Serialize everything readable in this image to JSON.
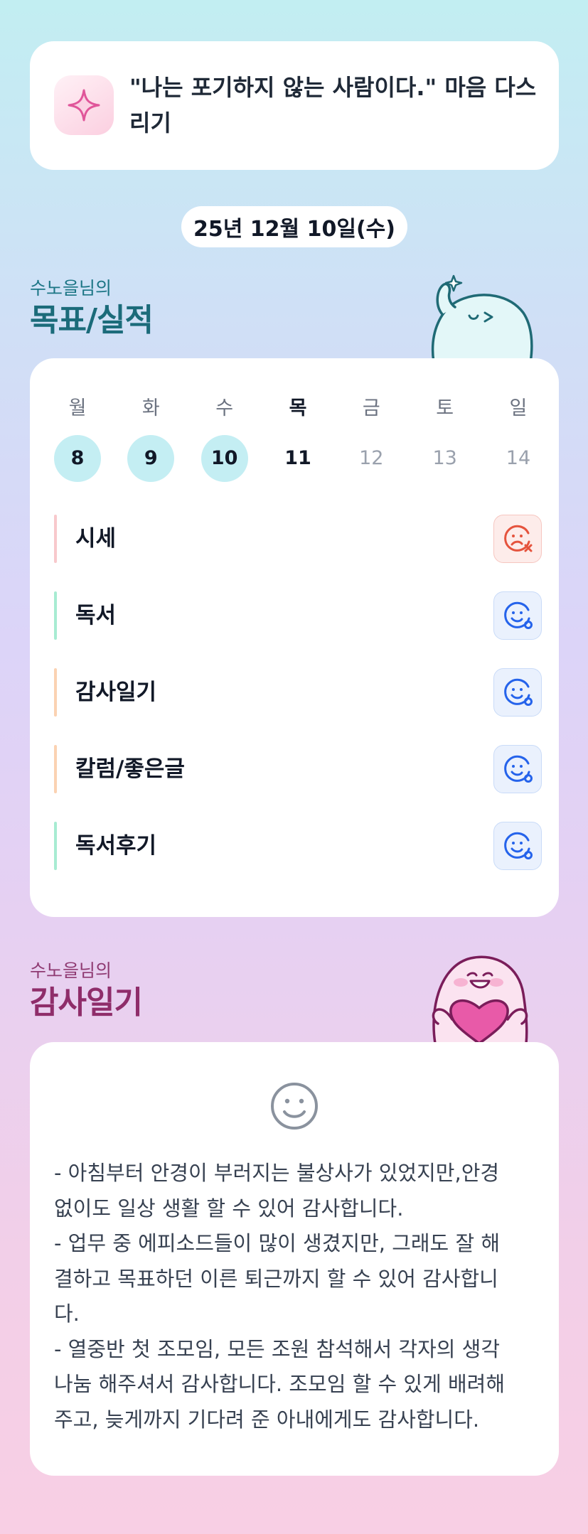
{
  "motto": {
    "text": "\"나는 포기하지 않는 사람이다.\" 마음 다스리기",
    "icon": "sparkle-icon"
  },
  "date": "25년 12월 10일(수)",
  "goals_section": {
    "subtitle": "수노을님의",
    "title": "목표/실적"
  },
  "week": {
    "days": [
      "월",
      "화",
      "수",
      "목",
      "금",
      "토",
      "일"
    ],
    "dates": [
      "8",
      "9",
      "10",
      "11",
      "12",
      "13",
      "14"
    ]
  },
  "tasks": [
    {
      "label": "시세",
      "status": "fail",
      "color": "#f8c9cc"
    },
    {
      "label": "독서",
      "status": "done",
      "color": "#a7ecd2"
    },
    {
      "label": "감사일기",
      "status": "done",
      "color": "#fbd2b2"
    },
    {
      "label": "칼럼/좋은글",
      "status": "done",
      "color": "#fbd2b2"
    },
    {
      "label": "독서후기",
      "status": "done",
      "color": "#a7ecd2"
    }
  ],
  "thanks_section": {
    "subtitle": "수노을님의",
    "title": "감사일기"
  },
  "journal": {
    "icon": "smile-icon",
    "text": "- 아침부터 안경이 부러지는 불상사가 있었지만,안경\n없이도 일상 생활 할 수 있어 감사합니다.\n- 업무 중 에피소드들이 많이 생겼지만, 그래도 잘 해\n결하고 목표하던 이른 퇴근까지 할 수 있어 감사합니\n다.\n- 열중반 첫 조모임, 모든 조원 참석해서 각자의 생각\n나눔 해주셔서 감사합니다. 조모임 할 수 있게 배려해\n주고, 늦게까지 기다려 준 아내에게도 감사합니다."
  },
  "colors": {
    "teal_title": "#1b6b7a",
    "pink_title": "#8f2d6a",
    "done_day": "#c4eef3",
    "fail_icon": "#e5533d",
    "ok_icon": "#2563eb"
  }
}
